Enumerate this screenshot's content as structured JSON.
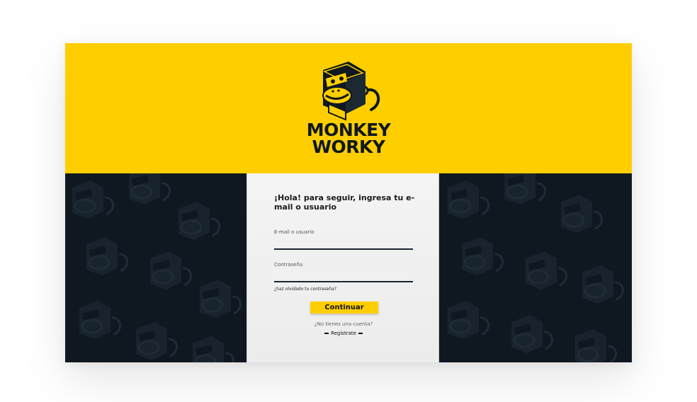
{
  "brand": {
    "line1": "MONKEY",
    "line2": "WORKY",
    "logo_icon": "monkey-cube-icon",
    "color_yellow": "#FFCE00",
    "color_dark": "#0f1820"
  },
  "login": {
    "greeting": "¡Hola! para seguir, ingresa tu e-mail o usuario",
    "email_label": "E-mail o usuario",
    "email_value": "",
    "password_label": "Contraseña",
    "password_value": "",
    "forgot_link": "¿haz olvidado tu contraseña?",
    "continue_button": "Continuar",
    "no_account_text": "¿No tienes una cuenta?",
    "register_link": "Regístrate"
  }
}
